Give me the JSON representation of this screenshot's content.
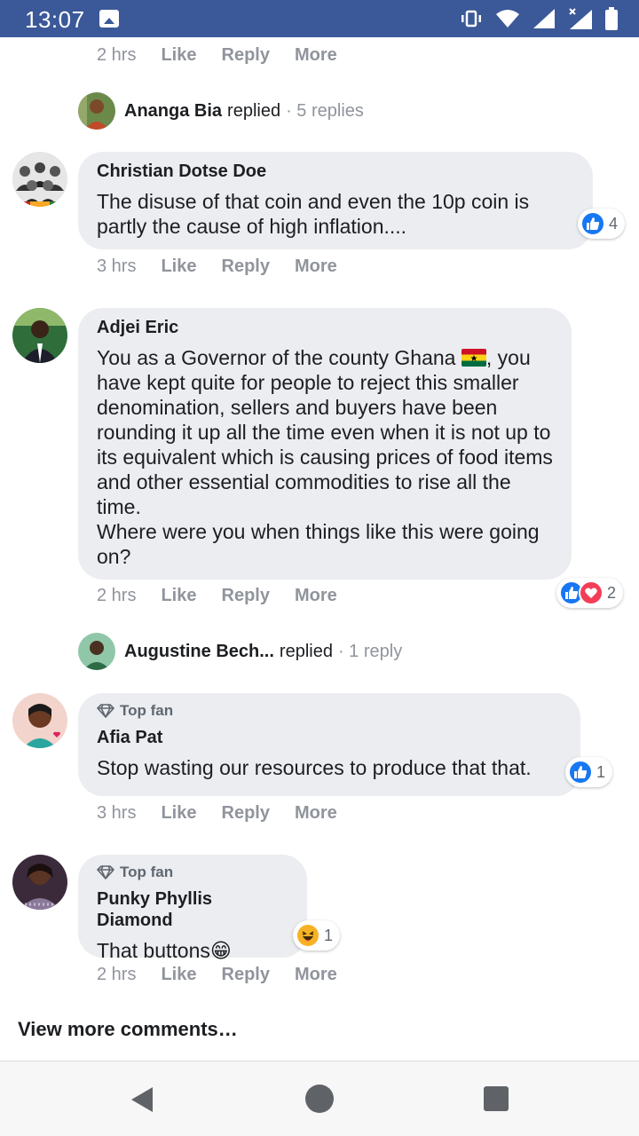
{
  "status_bar": {
    "time": "13:07"
  },
  "comments": [
    {
      "meta": {
        "time": "2 hrs",
        "like": "Like",
        "reply": "Reply",
        "more": "More"
      }
    },
    {
      "reply_summary": {
        "name": "Ananga Bia",
        "replied": "replied",
        "count": "· 5 replies"
      }
    },
    {
      "author": "Christian Dotse Doe",
      "text": "The disuse of that coin and even the 10p coin is partly the cause of high inflation....",
      "reactions": {
        "types": [
          "like"
        ],
        "count": "4"
      },
      "meta": {
        "time": "3 hrs",
        "like": "Like",
        "reply": "Reply",
        "more": "More"
      }
    },
    {
      "author": "Adjei Eric",
      "text_before_flag": "You as a Governor of the county Ghana ",
      "text_after_flag": ", you have kept quite for people to reject this smaller denomination, sellers and buyers have been rounding it up all the time even when it is not up to its equivalent which is causing prices of food items and other essential commodities to rise all the time.\nWhere were you when things like this were going on?",
      "reactions": {
        "types": [
          "like",
          "love"
        ],
        "count": "2"
      },
      "meta": {
        "time": "2 hrs",
        "like": "Like",
        "reply": "Reply",
        "more": "More"
      }
    },
    {
      "reply_summary": {
        "name": "Augustine Bech...",
        "replied": "replied",
        "count": "· 1 reply"
      }
    },
    {
      "badge": "Top fan",
      "author": "Afia Pat",
      "text": "Stop wasting our resources to produce that that.",
      "reactions": {
        "types": [
          "like"
        ],
        "count": "1"
      },
      "meta": {
        "time": "3 hrs",
        "like": "Like",
        "reply": "Reply",
        "more": "More"
      }
    },
    {
      "badge": "Top fan",
      "author": "Punky Phyllis Diamond",
      "text": "That buttons",
      "emoji": "😁",
      "reactions": {
        "types": [
          "haha"
        ],
        "count": "1"
      },
      "meta": {
        "time": "2 hrs",
        "like": "Like",
        "reply": "Reply",
        "more": "More"
      }
    }
  ],
  "view_more": "View more comments…",
  "colors": {
    "status_bar": "#3b5998",
    "bubble": "#ebedf0",
    "meta_text": "#90949c",
    "like_blue": "#1877f2",
    "love_red": "#f33e58",
    "haha_yellow": "#f7b125"
  }
}
